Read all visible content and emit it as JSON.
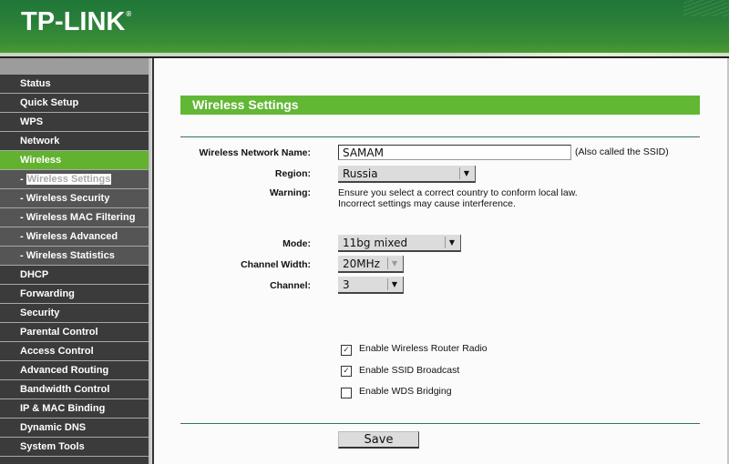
{
  "header": {
    "logo": "TP-LINK",
    "logo_mark": "®"
  },
  "sidebar": {
    "items": [
      {
        "label": "Status",
        "type": "main"
      },
      {
        "label": "Quick Setup",
        "type": "main"
      },
      {
        "label": "WPS",
        "type": "main"
      },
      {
        "label": "Network",
        "type": "main"
      },
      {
        "label": "Wireless",
        "type": "main",
        "active": true
      },
      {
        "label": "Wireless Settings",
        "prefix": "- ",
        "type": "sub",
        "selected": true
      },
      {
        "label": "- Wireless Security",
        "type": "sub"
      },
      {
        "label": "- Wireless MAC Filtering",
        "type": "sub"
      },
      {
        "label": "- Wireless Advanced",
        "type": "sub"
      },
      {
        "label": "- Wireless Statistics",
        "type": "sub"
      },
      {
        "label": "DHCP",
        "type": "main"
      },
      {
        "label": "Forwarding",
        "type": "main"
      },
      {
        "label": "Security",
        "type": "main"
      },
      {
        "label": "Parental Control",
        "type": "main"
      },
      {
        "label": "Access Control",
        "type": "main"
      },
      {
        "label": "Advanced Routing",
        "type": "main"
      },
      {
        "label": "Bandwidth Control",
        "type": "main"
      },
      {
        "label": "IP & MAC Binding",
        "type": "main"
      },
      {
        "label": "Dynamic DNS",
        "type": "main"
      },
      {
        "label": "System Tools",
        "type": "main"
      }
    ]
  },
  "page": {
    "title": "Wireless Settings",
    "ssid": {
      "label": "Wireless Network Name:",
      "value": "SAMAM",
      "hint": "(Also called the SSID)"
    },
    "region": {
      "label": "Region:",
      "value": "Russia"
    },
    "warning": {
      "label": "Warning:",
      "line1": "Ensure you select a correct country to conform local law.",
      "line2": "Incorrect settings may cause interference."
    },
    "mode": {
      "label": "Mode:",
      "value": "11bg mixed"
    },
    "channel_width": {
      "label": "Channel Width:",
      "value": "20MHz",
      "disabled": true
    },
    "channel": {
      "label": "Channel:",
      "value": "3"
    },
    "checkboxes": [
      {
        "label": "Enable Wireless Router Radio",
        "checked": true
      },
      {
        "label": "Enable SSID Broadcast",
        "checked": true
      },
      {
        "label": "Enable WDS Bridging",
        "checked": false
      }
    ],
    "save_label": "Save"
  },
  "colors": {
    "header_green": "#2a7f38",
    "accent_green": "#62b735",
    "sidebar_dark": "#3b3b3b",
    "sidebar_sub": "#555555"
  }
}
